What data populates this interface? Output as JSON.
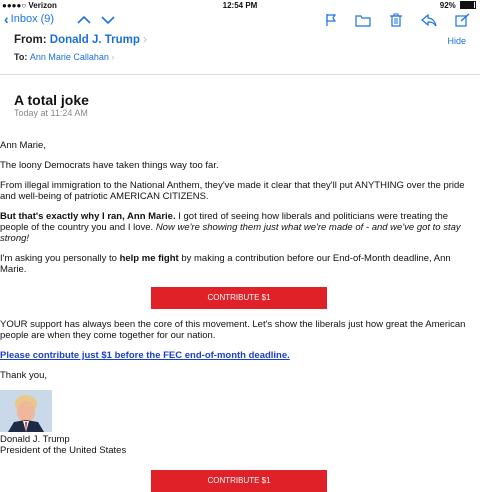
{
  "status": {
    "carrier": "●●●●○ Verizon",
    "time": "12:54 PM",
    "battery_pct": "92%",
    "battery_level": 0.92
  },
  "nav": {
    "back_label": "Inbox (9)",
    "icons": [
      "chevron-up-icon",
      "chevron-down-icon",
      "flag-icon",
      "folder-icon",
      "trash-icon",
      "reply-icon",
      "compose-icon"
    ]
  },
  "header": {
    "from_label": "From:",
    "from_name": "Donald J. Trump",
    "to_label": "To:",
    "to_name": "Ann Marie Callahan",
    "hide_label": "Hide",
    "chevron": "›"
  },
  "message": {
    "subject": "A total joke",
    "date": "Today at 11:24 AM",
    "greeting": "Ann Marie,",
    "p1": "The loony Democrats have taken things way too far.",
    "p2": "From illegal immigration to the National Anthem, they've made it clear that they'll put ANYTHING over the pride and well-being of patriotic AMERICAN CITIZENS.",
    "p3_bold": "But that's exactly why I ran, Ann Marie.",
    "p3_text": " I got tired of seeing how liberals and politicians were treating the people of the country you and I love. ",
    "p3_italic": "Now we're showing them just what we're made of - and we've got to stay strong!",
    "p4_pre": "I'm asking you personally to ",
    "p4_bold": "help me fight",
    "p4_post": " by making a contribution before our End-of-Month deadline, Ann Marie.",
    "cta1": "CONTRIBUTE $1",
    "p5": "YOUR support has always been the core of this movement. Let's show the liberals just how great the American people are when they come together for our nation.",
    "link": "Please contribute just $1 before the FEC end-of-month deadline.",
    "thanks": "Thank you,",
    "sig_name": "Donald J. Trump",
    "sig_title": "President of the United States",
    "cta2": "CONTRIBUTE $1"
  },
  "colors": {
    "accent": "#1a6fd6",
    "cta": "#e02127",
    "link": "#1a3fc9"
  }
}
